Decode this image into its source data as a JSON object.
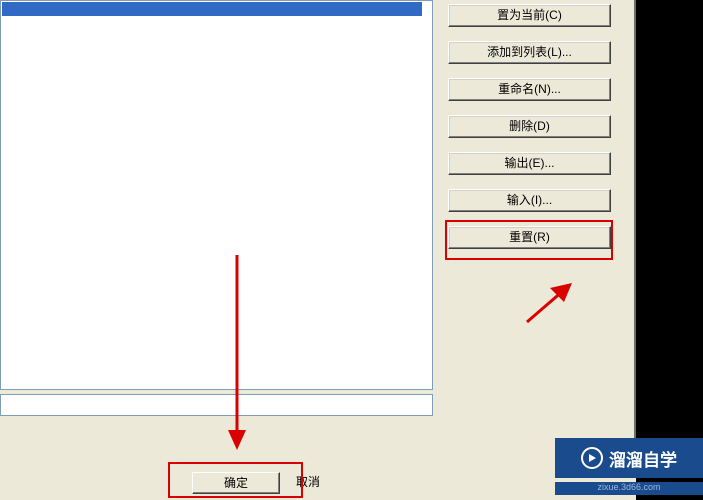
{
  "buttons": {
    "set_current": "置为当前(C)",
    "add_to_list": "添加到列表(L)...",
    "rename": "重命名(N)...",
    "delete": "删除(D)",
    "export": "输出(E)...",
    "import": "输入(I)...",
    "reset": "重置(R)"
  },
  "dialog": {
    "ok": "确定",
    "cancel": "取消"
  },
  "watermark": {
    "text": "溜溜自学",
    "url": "zixue.3d66.com"
  },
  "annotations": {
    "highlight_color": "#d90000"
  }
}
